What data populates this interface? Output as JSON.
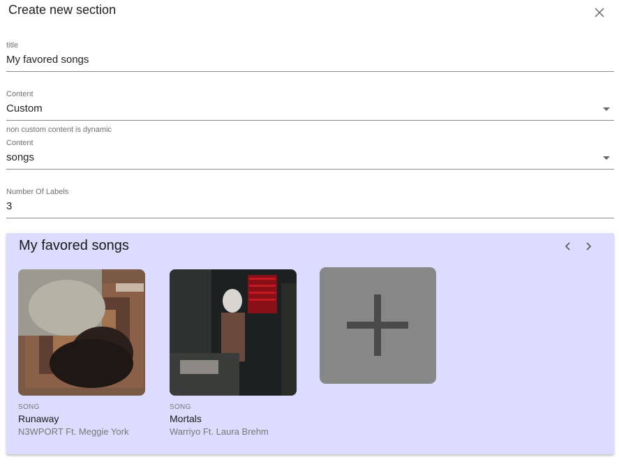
{
  "dialog": {
    "title": "Create new section",
    "close_icon": "close-icon"
  },
  "form": {
    "title_field": {
      "label": "title",
      "value": "My favored songs"
    },
    "content_type_field": {
      "label": "Content",
      "value": "Custom"
    },
    "hint": "non custom content is dynamic",
    "content_field": {
      "label": "Content",
      "value": "songs"
    },
    "labels_field": {
      "label": "Number Of Labels",
      "value": "3"
    }
  },
  "preview": {
    "title": "My favored songs",
    "background": "#dcdcff",
    "prev_icon": "chevron-left-icon",
    "next_icon": "chevron-right-icon",
    "songs": [
      {
        "kind": "SONG",
        "name": "Runaway",
        "artist": "N3WPORT Ft. Meggie York"
      },
      {
        "kind": "SONG",
        "name": "Mortals",
        "artist": "Warriyo Ft. Laura Brehm"
      }
    ],
    "add_icon": "plus-icon"
  }
}
